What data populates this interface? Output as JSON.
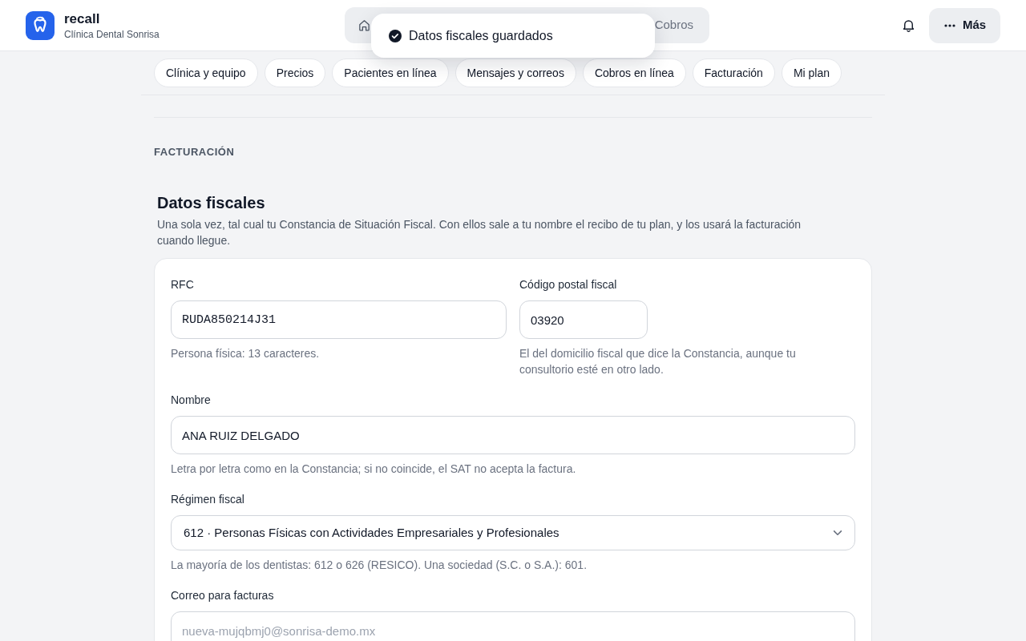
{
  "header": {
    "brand": {
      "name": "recall",
      "subtitle": "Clínica Dental Sonrisa"
    },
    "nav": [
      {
        "kind": "icon_only"
      },
      {
        "kind": "link",
        "label": "Cobros"
      }
    ],
    "more_button": {
      "label": "Más"
    }
  },
  "toast": {
    "message": "Datos fiscales guardados"
  },
  "section_tabs": [
    {
      "label": "Clínica y equipo",
      "selected": false
    },
    {
      "label": "Precios",
      "selected": false
    },
    {
      "label": "Pacientes en línea",
      "selected": false
    },
    {
      "label": "Mensajes y correos",
      "selected": false
    },
    {
      "label": "Cobros en línea",
      "selected": false
    },
    {
      "label": "Facturación",
      "selected": false
    },
    {
      "label": "Mi plan",
      "selected": false
    }
  ],
  "section": {
    "eyebrow": "FACTURACIÓN",
    "title": "Datos fiscales",
    "description": "Una sola vez, tal cual tu Constancia de Situación Fiscal. Con ellos sale a tu nombre el recibo de tu plan, y los usará la facturación cuando llegue.",
    "rows": [
      {
        "fields": [
          {
            "kind": "mono",
            "label": "RFC",
            "value": "RUDA850214J31",
            "help": "Persona física: 13 caracteres."
          },
          {
            "kind": "short",
            "label": "Código postal fiscal",
            "value": "03920",
            "help": "El del domicilio fiscal que dice la Constancia, aunque tu consultorio esté en otro lado."
          }
        ]
      },
      {
        "fields": [
          {
            "kind": "text",
            "label": "Nombre",
            "value": "ANA RUIZ DELGADO",
            "help": "Letra por letra como en la Constancia; si no coincide, el SAT no acepta la factura."
          }
        ]
      },
      {
        "fields": [
          {
            "kind": "select",
            "label": "Régimen fiscal",
            "value": "612 · Personas Físicas con Actividades Empresariales y Profesionales",
            "help": "La mayoría de los dentistas: 612 o 626 (RESICO). Una sociedad (S.C. o S.A.): 601."
          }
        ]
      },
      {
        "fields": [
          {
            "kind": "text",
            "label": "Correo para facturas",
            "placeholder": "nueva-mujqbmj0@sonrisa-demo.mx"
          }
        ]
      }
    ]
  }
}
